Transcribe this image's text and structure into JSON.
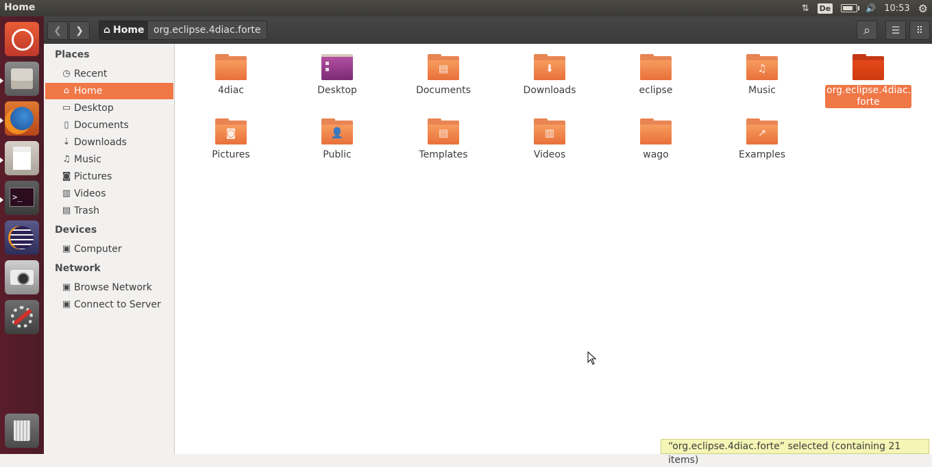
{
  "top_panel": {
    "title": "Home",
    "keyboard": "De",
    "time": "10:53",
    "network_glyph": "⇅",
    "volume_glyph": "🔊",
    "power_glyph": "⚙"
  },
  "launcher": {
    "items": [
      {
        "name": "ubuntu-dash",
        "active": false
      },
      {
        "name": "files",
        "active": true
      },
      {
        "name": "firefox",
        "active": true
      },
      {
        "name": "text-editor",
        "active": true
      },
      {
        "name": "terminal",
        "active": true
      },
      {
        "name": "eclipse",
        "active": false
      },
      {
        "name": "camera",
        "active": false
      },
      {
        "name": "system-settings",
        "active": false
      },
      {
        "name": "trash",
        "active": false
      }
    ]
  },
  "header": {
    "back_glyph": "❮",
    "forward_glyph": "❯",
    "home_label": "Home",
    "home_glyph": "⌂",
    "crumb": "org.eclipse.4diac.forte",
    "search_glyph": "⌕",
    "menu_glyph": "☰",
    "grid_glyph": "⠿"
  },
  "sidebar": {
    "places_header": "Places",
    "places": [
      {
        "label": "Recent",
        "icon": "clock-icon",
        "glyph": "◷"
      },
      {
        "label": "Home",
        "icon": "home-icon",
        "glyph": "⌂",
        "active": true
      },
      {
        "label": "Desktop",
        "icon": "desktop-icon",
        "glyph": "▭"
      },
      {
        "label": "Documents",
        "icon": "document-icon",
        "glyph": "▯"
      },
      {
        "label": "Downloads",
        "icon": "download-icon",
        "glyph": "⇣"
      },
      {
        "label": "Music",
        "icon": "music-icon",
        "glyph": "♫"
      },
      {
        "label": "Pictures",
        "icon": "camera-icon",
        "glyph": "◙"
      },
      {
        "label": "Videos",
        "icon": "film-icon",
        "glyph": "▥"
      },
      {
        "label": "Trash",
        "icon": "trash-icon",
        "glyph": "▤"
      }
    ],
    "devices_header": "Devices",
    "devices": [
      {
        "label": "Computer",
        "icon": "drive-icon",
        "glyph": "▣"
      }
    ],
    "network_header": "Network",
    "network": [
      {
        "label": "Browse Network",
        "icon": "network-icon",
        "glyph": "▣"
      },
      {
        "label": "Connect to Server",
        "icon": "server-icon",
        "glyph": "▣"
      }
    ]
  },
  "files": [
    {
      "name": "4diac",
      "kind": "folder",
      "emblem": ""
    },
    {
      "name": "Desktop",
      "kind": "desktop",
      "emblem": ""
    },
    {
      "name": "Documents",
      "kind": "folder",
      "emblem": "▤"
    },
    {
      "name": "Downloads",
      "kind": "folder",
      "emblem": "⬇"
    },
    {
      "name": "eclipse",
      "kind": "folder",
      "emblem": ""
    },
    {
      "name": "Music",
      "kind": "folder",
      "emblem": "♫"
    },
    {
      "name": "org.eclipse.4diac.forte",
      "display": [
        "org.eclipse.4diac.",
        "forte"
      ],
      "kind": "folder-dark",
      "emblem": "",
      "selected": true
    },
    {
      "name": "Pictures",
      "kind": "folder",
      "emblem": "◙"
    },
    {
      "name": "Public",
      "kind": "folder",
      "emblem": "👤"
    },
    {
      "name": "Templates",
      "kind": "folder",
      "emblem": "▤"
    },
    {
      "name": "Videos",
      "kind": "folder",
      "emblem": "▥"
    },
    {
      "name": "wago",
      "kind": "folder",
      "emblem": ""
    },
    {
      "name": "Examples",
      "kind": "folder",
      "emblem": "↗"
    }
  ],
  "status": "“org.eclipse.4diac.forte” selected  (containing 21 items)"
}
